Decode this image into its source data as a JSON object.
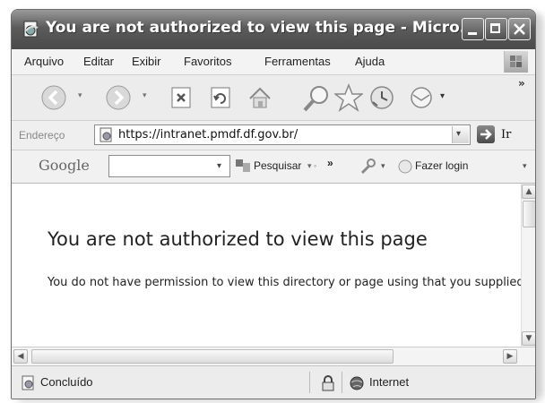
{
  "window": {
    "title": "You are not authorized to view this page - Micro..."
  },
  "menu": {
    "items": [
      "Arquivo",
      "Editar",
      "Exibir",
      "Favoritos",
      "Ferramentas",
      "Ajuda"
    ]
  },
  "toolbar": {
    "icons": [
      "back-icon",
      "forward-icon",
      "stop-icon",
      "refresh-icon",
      "home-icon",
      "search-icon",
      "favorites-icon",
      "history-icon",
      "mail-icon"
    ],
    "chevron": "»"
  },
  "address": {
    "label": "Endereço",
    "url": "https://intranet.pmdf.df.gov.br/",
    "go_label": "Ir"
  },
  "google_bar": {
    "logo": "Google",
    "search_label": "Pesquisar",
    "more": "»",
    "login_label": "Fazer login"
  },
  "content": {
    "title": "You are not authorized to view this page",
    "body": "You do not have permission to view this directory or page using that you supplied."
  },
  "status": {
    "text": "Concluído",
    "zone": "Internet"
  }
}
